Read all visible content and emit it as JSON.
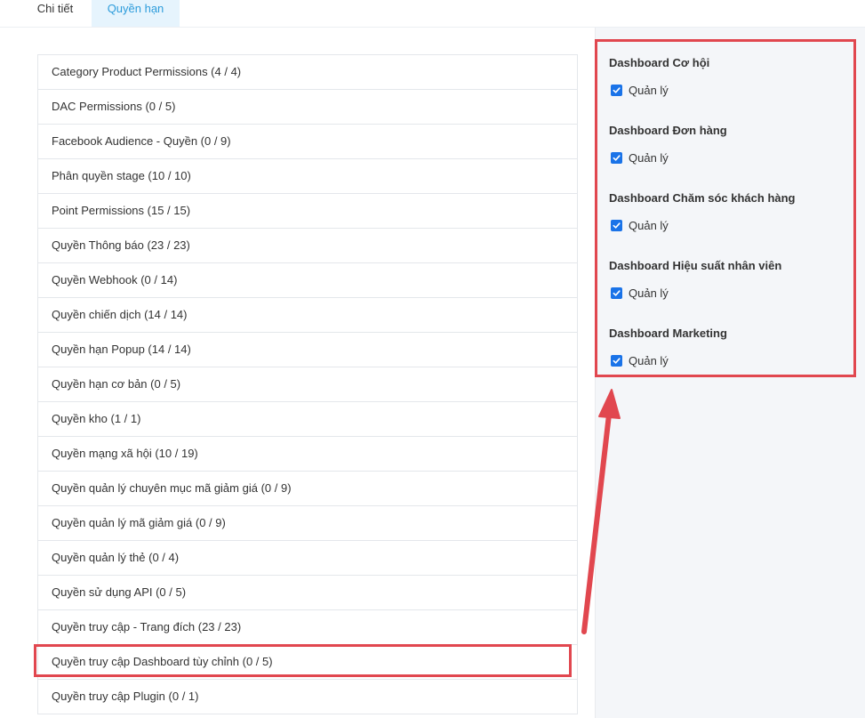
{
  "tabs": [
    {
      "label": "Chi tiết",
      "active": false
    },
    {
      "label": "Quyền hạn",
      "active": true
    }
  ],
  "permission_list": [
    "Category Product Permissions (4 / 4)",
    "DAC Permissions (0 / 5)",
    "Facebook Audience - Quyền (0 / 9)",
    "Phân quyền stage (10 / 10)",
    "Point Permissions (15 / 15)",
    "Quyền Thông báo (23 / 23)",
    "Quyền Webhook (0 / 14)",
    "Quyền chiến dịch (14 / 14)",
    "Quyền hạn Popup (14 / 14)",
    "Quyền hạn cơ bản (0 / 5)",
    "Quyền kho (1 / 1)",
    "Quyền mạng xã hội (10 / 19)",
    "Quyền quản lý chuyên mục mã giảm giá (0 / 9)",
    "Quyền quản lý mã giảm giá (0 / 9)",
    "Quyền quản lý thẻ (0 / 4)",
    "Quyền sử dụng API (0 / 5)",
    "Quyền truy cập - Trang đích (23 / 23)",
    "Quyền truy cập Dashboard tùy chỉnh (0 / 5)",
    "Quyền truy cập Plugin (0 / 1)"
  ],
  "dashboard_groups": [
    {
      "title": "Dashboard Cơ hội",
      "option": "Quản lý",
      "checked": true
    },
    {
      "title": "Dashboard Đơn hàng",
      "option": "Quản lý",
      "checked": true
    },
    {
      "title": "Dashboard Chăm sóc khách hàng",
      "option": "Quản lý",
      "checked": true
    },
    {
      "title": "Dashboard Hiệu suất nhân viên",
      "option": "Quản lý",
      "checked": true
    },
    {
      "title": "Dashboard Marketing",
      "option": "Quản lý",
      "checked": true
    }
  ],
  "colors": {
    "accent": "#2d9cdb",
    "checkbox": "#1a73e8",
    "annotation": "#e1474f"
  }
}
